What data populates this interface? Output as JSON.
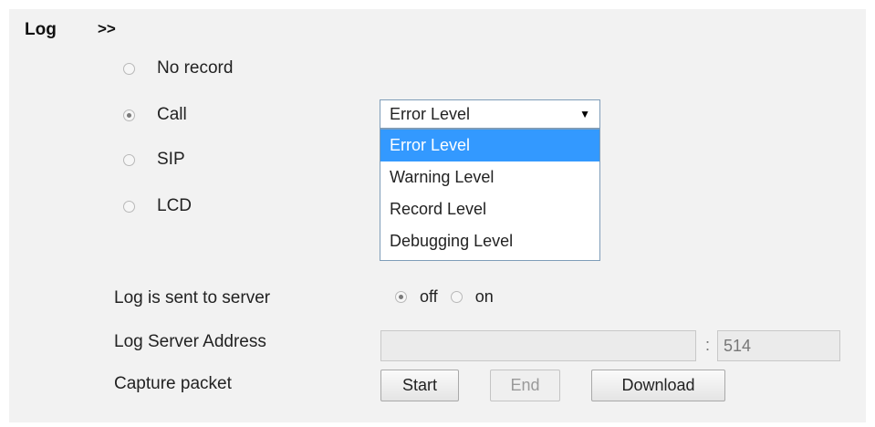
{
  "header": {
    "title": "Log",
    "arrows": ">>"
  },
  "log_options": [
    {
      "label": "No record",
      "checked": false
    },
    {
      "label": "Call",
      "checked": true
    },
    {
      "label": "SIP",
      "checked": false
    },
    {
      "label": "LCD",
      "checked": false
    }
  ],
  "level_select": {
    "value": "Error Level",
    "options": [
      "Error Level",
      "Warning Level",
      "Record Level",
      "Debugging Level"
    ],
    "selected_option": "Error Level"
  },
  "server_send": {
    "label": "Log is sent to server",
    "off_label": "off",
    "on_label": "on",
    "selected": "off"
  },
  "server_address": {
    "label": "Log Server Address",
    "address_value": "",
    "separator": ":",
    "port_value": "514"
  },
  "capture": {
    "label": "Capture packet",
    "start_label": "Start",
    "end_label": "End",
    "download_label": "Download"
  },
  "colors": {
    "panel_bg": "#f2f2f2",
    "highlight": "#3399ff",
    "select_border": "#7f9db9"
  }
}
